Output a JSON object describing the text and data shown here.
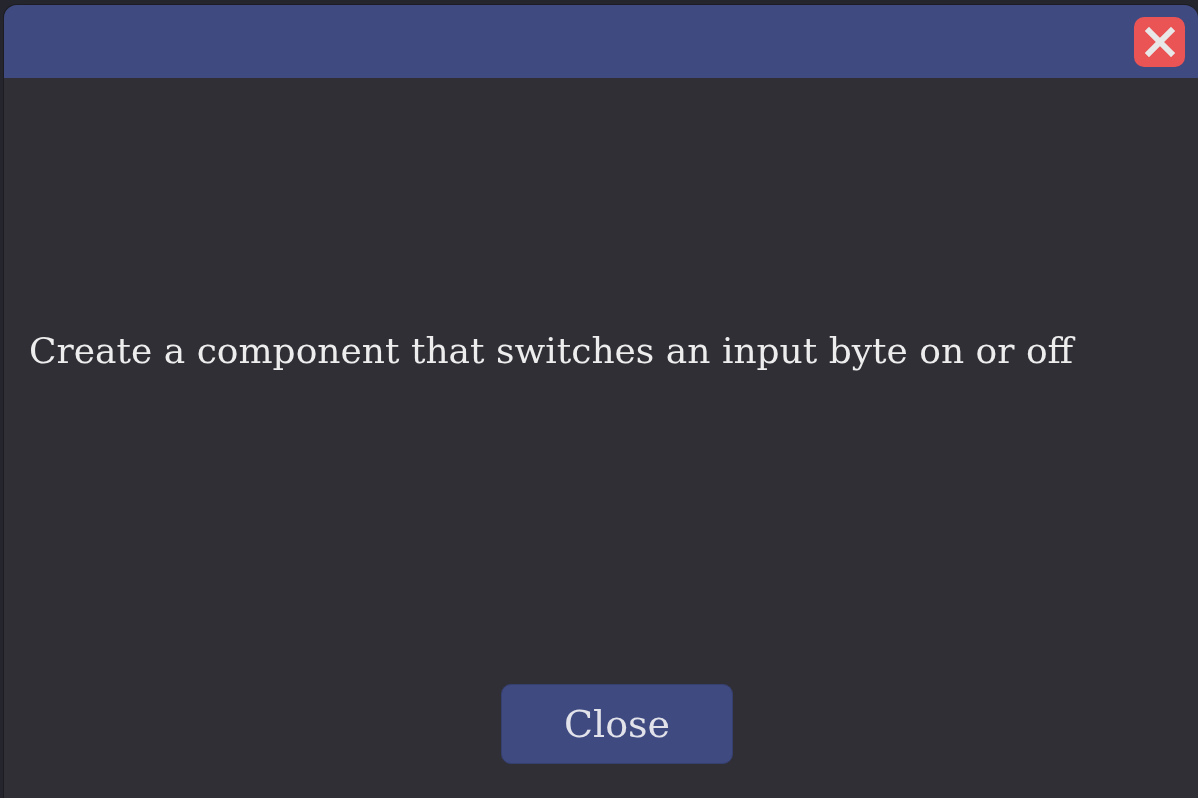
{
  "dialog": {
    "message": "Create a component that switches an input byte on or off",
    "close_button": {
      "label": "Close"
    }
  }
}
